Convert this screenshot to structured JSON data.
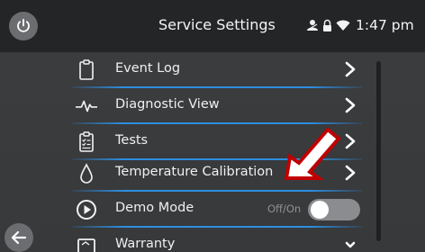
{
  "header": {
    "title": "Service Settings",
    "time": "1:47 pm",
    "icons": [
      "power-icon",
      "user-icon",
      "lock-icon",
      "wifi-icon"
    ]
  },
  "menu": {
    "items": [
      {
        "label": "Event Log",
        "icon": "clipboard-icon",
        "chevron": true
      },
      {
        "label": "Diagnostic View",
        "icon": "waveform-icon",
        "chevron": true
      },
      {
        "label": "Tests",
        "icon": "checklist-icon",
        "chevron": true
      },
      {
        "label": "Temperature Calibration",
        "icon": "droplet-icon",
        "chevron": true
      },
      {
        "label": "Demo Mode",
        "icon": "play-icon",
        "toggle_label": "Off/On",
        "toggle_on": false
      },
      {
        "label": "Warranty",
        "icon": "card-icon",
        "chevron": true
      }
    ]
  },
  "colors": {
    "header_bg": "#232527",
    "background": "#3a3c3e",
    "separator": "#2e8fe0",
    "callout": "#c00000"
  },
  "navigation": {
    "back_icon": "arrow-left-icon"
  }
}
